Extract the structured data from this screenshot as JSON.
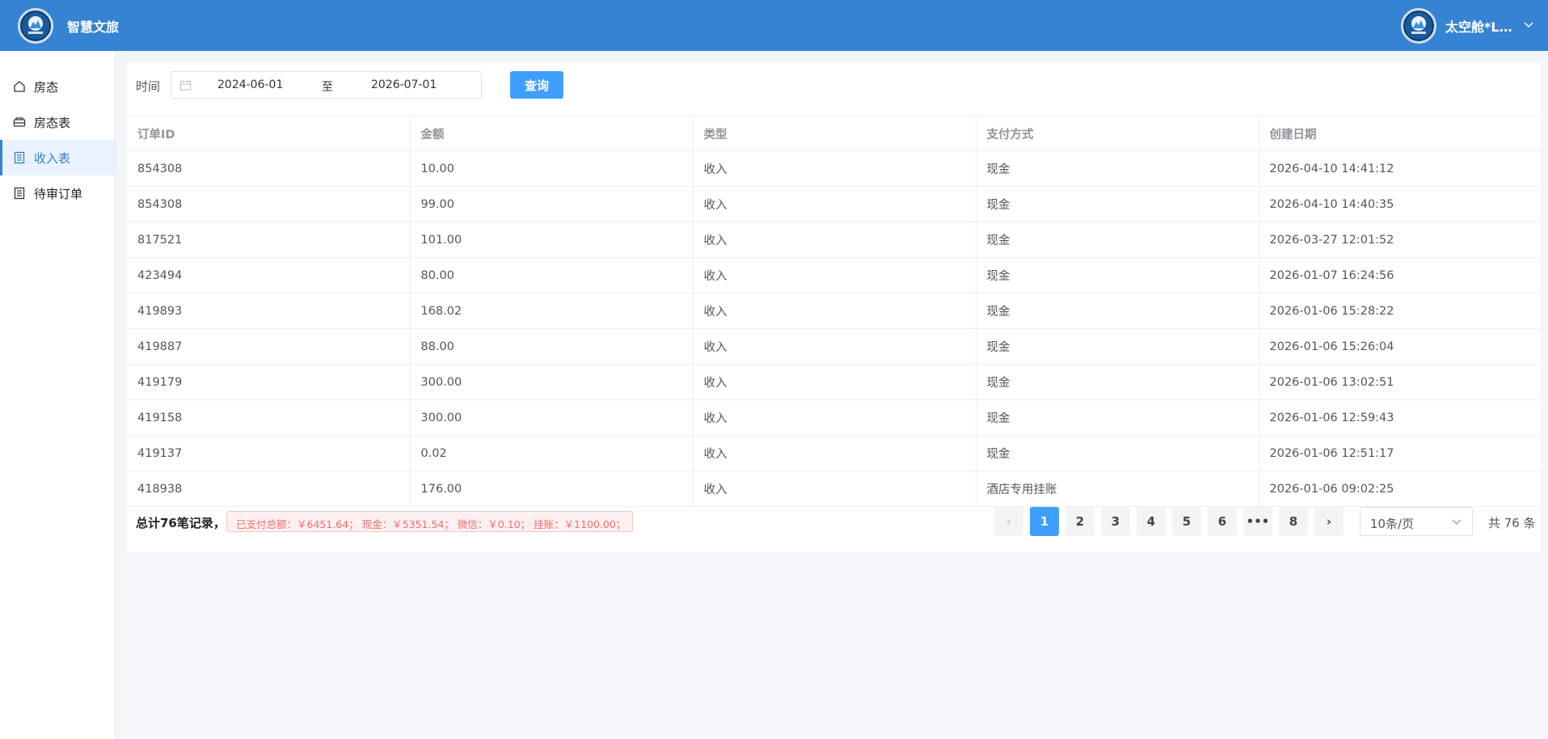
{
  "header": {
    "app_title": "智慧文旅",
    "user_name": "太空舱*Lo…",
    "logo_icon": "city-logo-icon",
    "accent": "#3583d2"
  },
  "sidebar": {
    "items": [
      {
        "label": "房态",
        "icon": "home-icon"
      },
      {
        "label": "房态表",
        "icon": "bed-icon"
      },
      {
        "label": "收入表",
        "icon": "document-icon",
        "active": true
      },
      {
        "label": "待审订单",
        "icon": "document-icon"
      }
    ]
  },
  "filter": {
    "time_label": "时间",
    "start_date": "2024-06-01",
    "separator": "至",
    "end_date": "2026-07-01",
    "query_button": "查询"
  },
  "table": {
    "columns": [
      "订单ID",
      "金额",
      "类型",
      "支付方式",
      "创建日期"
    ],
    "rows": [
      [
        "854308",
        "10.00",
        "收入",
        "现金",
        "2026-04-10 14:41:12"
      ],
      [
        "854308",
        "99.00",
        "收入",
        "现金",
        "2026-04-10 14:40:35"
      ],
      [
        "817521",
        "101.00",
        "收入",
        "现金",
        "2026-03-27 12:01:52"
      ],
      [
        "423494",
        "80.00",
        "收入",
        "现金",
        "2026-01-07 16:24:56"
      ],
      [
        "419893",
        "168.02",
        "收入",
        "现金",
        "2026-01-06 15:28:22"
      ],
      [
        "419887",
        "88.00",
        "收入",
        "现金",
        "2026-01-06 15:26:04"
      ],
      [
        "419179",
        "300.00",
        "收入",
        "现金",
        "2026-01-06 13:02:51"
      ],
      [
        "419158",
        "300.00",
        "收入",
        "现金",
        "2026-01-06 12:59:43"
      ],
      [
        "419137",
        "0.02",
        "收入",
        "现金",
        "2026-01-06 12:51:17"
      ],
      [
        "418938",
        "176.00",
        "收入",
        "酒店专用挂账",
        "2026-01-06 09:02:25"
      ]
    ]
  },
  "footer": {
    "total_text": "总计76笔记录，",
    "summary": "已支付总额：￥6451.64；  现金：￥5351.54；  微信：￥0.10；  挂账：￥1100.00；",
    "pages": [
      "1",
      "2",
      "3",
      "4",
      "5",
      "6",
      "•••",
      "8"
    ],
    "current_page": "1",
    "prev_label": "‹",
    "next_label": "›",
    "page_size": "10条/页",
    "total_count": "共 76 条"
  }
}
